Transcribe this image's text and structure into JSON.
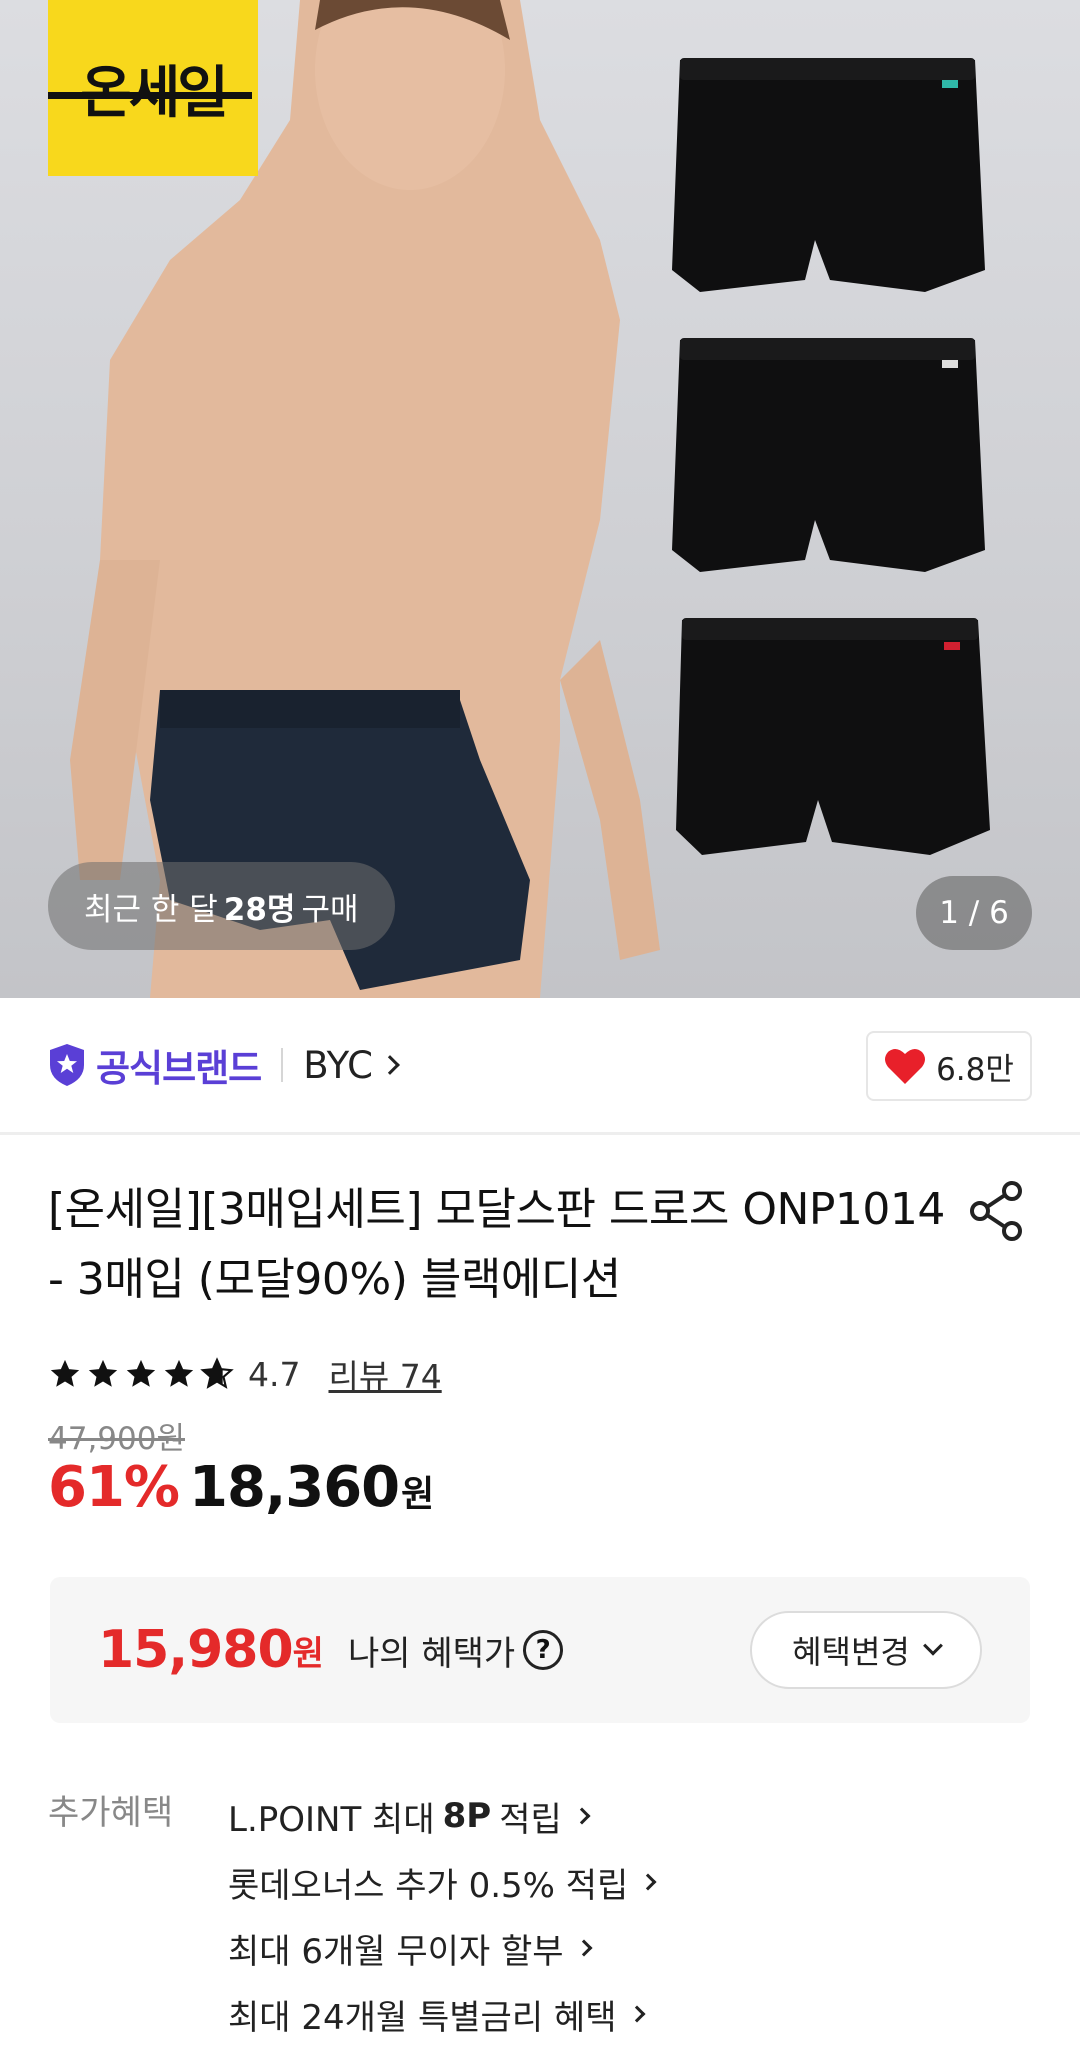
{
  "hero": {
    "sale_badge": "온세일",
    "recent_purchase": {
      "prefix": "최근 한 달",
      "count": "28명",
      "suffix": "구매"
    },
    "counter": "1 / 6"
  },
  "brand": {
    "official_label": "공식브랜드",
    "name": "BYC",
    "likes": "6.8만"
  },
  "product": {
    "title": "[온세일][3매입세트] 모달스판 드로즈 ONP1014 - 3매입 (모달90%) 블랙에디션",
    "rating": "4.7",
    "review_link": "리뷰 74",
    "original_price": "47,900원",
    "discount": "61%",
    "price": "18,360",
    "price_unit": "원"
  },
  "benefit": {
    "price": "15,980",
    "price_unit": "원",
    "label": "나의 혜택가",
    "help_icon": "?",
    "change_button": "혜택변경"
  },
  "extra_benefits": {
    "label": "추가혜택",
    "items": [
      {
        "pre": "L.POINT 최대",
        "bold": "8P",
        "post": "적립"
      },
      {
        "pre": "롯데오너스 추가 0.5% 적립",
        "bold": "",
        "post": ""
      },
      {
        "pre": "최대 6개월 무이자 할부",
        "bold": "",
        "post": ""
      },
      {
        "pre": "최대 24개월 특별금리 혜택",
        "bold": "",
        "post": ""
      }
    ]
  },
  "colors": {
    "accent_red": "#e42a2a",
    "brand_purple": "#5a3fd6",
    "badge_yellow": "#f8d81c",
    "heart_red": "#e8202a"
  },
  "icons": [
    "shield-star-icon",
    "chevron-right-icon",
    "heart-icon",
    "share-icon",
    "star-icon",
    "help-circle-icon",
    "chevron-down-icon"
  ]
}
